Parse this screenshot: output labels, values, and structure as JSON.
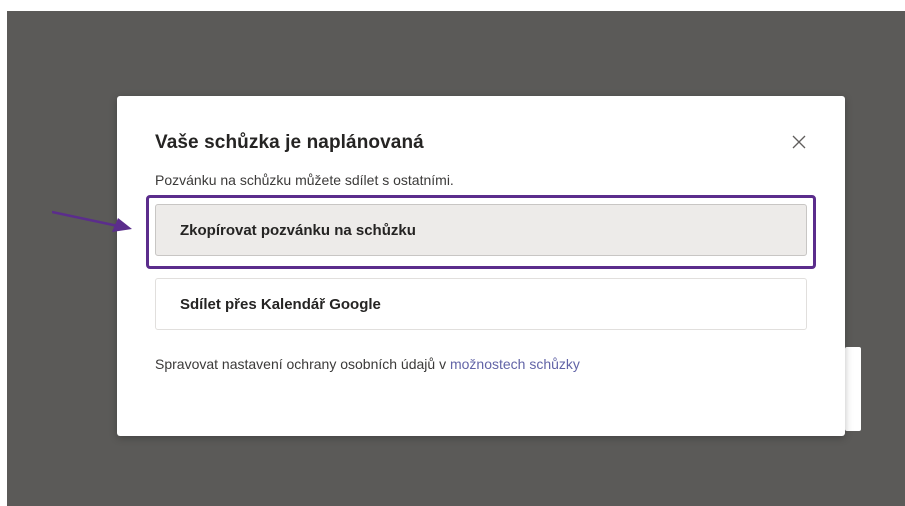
{
  "dialog": {
    "title": "Vaše schůzka je naplánovaná",
    "subtitle": "Pozvánku na schůzku můžete sdílet s ostatními.",
    "close_icon": "close-icon"
  },
  "actions": {
    "copy_label": "Zkopírovat pozvánku na schůzku",
    "google_label": "Sdílet přes Kalendář Google"
  },
  "privacy": {
    "text": "Spravovat nastavení ochrany osobních údajů v ",
    "link": "možnostech schůzky"
  },
  "colors": {
    "backdrop": "#5b5a58",
    "highlight": "#5b2d8c",
    "link": "#6264a7",
    "selected_button": "#edebe9"
  },
  "annotations": {
    "arrow_icon": "arrow-right-icon"
  }
}
